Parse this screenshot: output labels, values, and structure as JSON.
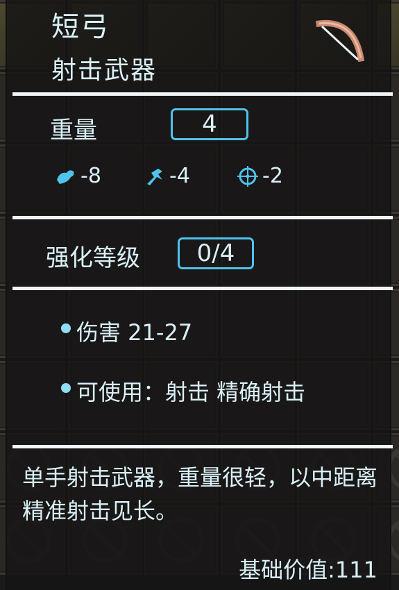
{
  "item": {
    "name": "短弓",
    "category": "射击武器",
    "icon": "bow-icon"
  },
  "weight": {
    "label": "重量",
    "value": "4"
  },
  "modifiers": [
    {
      "icon": "arm-strength-icon",
      "value": "-8",
      "color": "#4fc3ec"
    },
    {
      "icon": "agility-run-icon",
      "value": "-4",
      "color": "#4fc3ec"
    },
    {
      "icon": "accuracy-crosshair-icon",
      "value": "-2",
      "color": "#4fc3ec"
    }
  ],
  "upgrade": {
    "label": "强化等级",
    "value": "0/4"
  },
  "properties": [
    {
      "text": "伤害 21-27"
    },
    {
      "text": "可使用：射击 精确射击"
    }
  ],
  "description": "单手射击武器，重量很轻，以中距离精准射击见长。",
  "base_value": "基础价值:111",
  "colors": {
    "accent": "#4fc3ec",
    "text": "#d9f0f7",
    "panel": "#161414"
  }
}
